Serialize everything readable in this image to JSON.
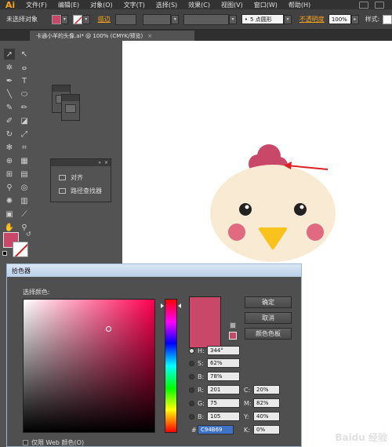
{
  "menubar": {
    "logo": "Ai",
    "items": [
      "文件(F)",
      "编辑(E)",
      "对象(O)",
      "文字(T)",
      "选择(S)",
      "效果(C)",
      "视图(V)",
      "窗口(W)",
      "帮助(H)"
    ]
  },
  "controlbar": {
    "selection_status": "未选择对象",
    "stroke_label": "描边",
    "brush_value": "5 点圆形",
    "opacity_label": "不透明度",
    "opacity_value": "100%",
    "style_label": "样式",
    "fill_color": "#c94869"
  },
  "document_tab": {
    "title": "卡通小羊的头像.ai* @ 100% (CMYK/预览)"
  },
  "panel": {
    "items": [
      "对齐",
      "路径查找器"
    ]
  },
  "color_picker": {
    "title": "拾色器",
    "select_color_label": "选择颜色:",
    "buttons": {
      "ok": "确定",
      "cancel": "取消",
      "swatches": "颜色色板"
    },
    "hsb": {
      "h_label": "H:",
      "h": "344°",
      "s_label": "S:",
      "s": "62%",
      "b_label": "B:",
      "b": "78%"
    },
    "rgb": {
      "r_label": "R:",
      "r": "201",
      "g_label": "G:",
      "g": "75",
      "b_label": "B:",
      "b": "105"
    },
    "cmyk": {
      "c_label": "C:",
      "c": "20%",
      "m_label": "M:",
      "m": "82%",
      "y_label": "Y:",
      "y": "40%",
      "k_label": "K:",
      "k": "0%"
    },
    "hex_label": "#",
    "hex": "C94B69",
    "web_only_label": "仅限 Web 颜色(O)",
    "current_color": "#c94869"
  },
  "artwork": {
    "face_color": "#f9ead3",
    "comb_color": "#c94869",
    "cheek_color": "#e06a80",
    "beak_color": "#f9c21d",
    "arrow_color": "#e02020"
  },
  "watermark": "Baidu 经验"
}
